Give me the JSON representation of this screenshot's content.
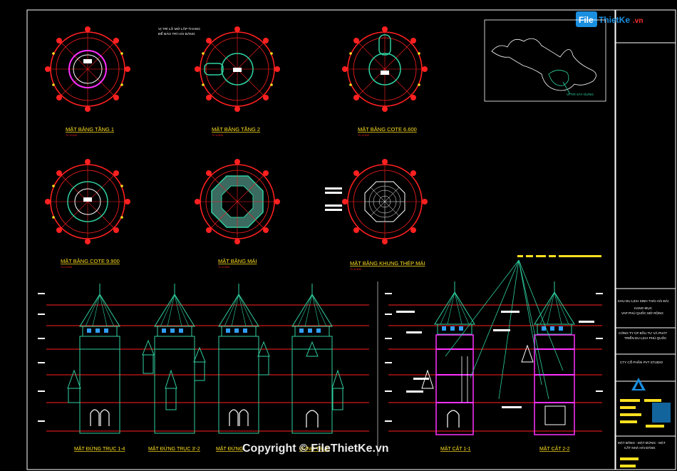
{
  "logo": {
    "file": "File",
    "rest": "ThietKe",
    "domain": ".vn"
  },
  "titles": {
    "floor1": "MẶT BẰNG TẦNG 1",
    "floor2": "MẶT BẰNG TẦNG 2",
    "cote6600": "MẶT BẰNG COTE 6.600",
    "cote9900": "MẶT BẰNG COTE 9.900",
    "roof": "MẶT BẰNG MÁI",
    "roofFrame": "MẶT BẰNG KHUNG THÉP MÁI",
    "elev14": "MẶT ĐỨNG TRỤC 1-4",
    "elev3": "MẶT ĐỨNG TRỤC 3'-2",
    "elevC": "MẶT ĐỨNG",
    "elevD": "ĐỨNG TRỤC",
    "sec11": "MẶT CẮT 1-1",
    "sec22": "MẶT CẮT 2-2"
  },
  "scale": "TL:1/100",
  "notes": {
    "ladder1": "VỊ TRÍ LỖ MỞ LẮP THANG",
    "ladder2": "ĐỂ BẢO TRÌ HẢI ĐĂNG",
    "site": "VỊ TRÍ XÂY DỰNG"
  },
  "titleblock": {
    "project": "KHU DU LỊCH SINH THÁI HẢI ĐẢI",
    "item": "HẠNG MỤC",
    "item2": "VAP PHÚ QUỐC MỞ RỘNG",
    "owner": "CÔNG TY CP ĐẦU TƯ VÀ PHÁT",
    "owner2": "TRIỂN DU LỊCH PHÚ QUỐC",
    "studio": "CTY CỔ PHẦN PVT STUDIO",
    "drawing": "MẶT BẰNG - MẶT ĐỨNG - MẶT",
    "drawing2": "CẮT NHÀ HẢI ĐĂNG"
  },
  "copyright": "Copyright © FileThietKe.vn",
  "colors": {
    "red": "#ff2020",
    "green": "#2fd0a0",
    "cyan": "#30e0ff",
    "yellow": "#ffe020",
    "magenta": "#ff30ff",
    "white": "#ffffff"
  }
}
